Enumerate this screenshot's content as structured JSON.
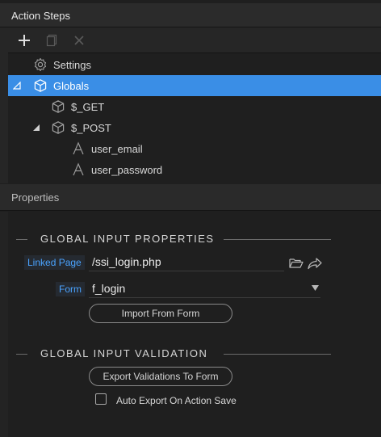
{
  "action_steps": {
    "title": "Action Steps",
    "toolbar": {
      "add_icon": "plus-icon",
      "copy_icon": "copy-icon",
      "delete_icon": "close-icon"
    },
    "tree": [
      {
        "label": "Settings",
        "icon": "gear-icon"
      },
      {
        "label": "Globals",
        "icon": "cube-icon",
        "expanded": true,
        "selected": true
      },
      {
        "label": "$_GET",
        "icon": "cube-icon"
      },
      {
        "label": "$_POST",
        "icon": "cube-icon",
        "expanded": true
      },
      {
        "label": "user_email",
        "icon": "text-a-icon"
      },
      {
        "label": "user_password",
        "icon": "text-a-icon"
      }
    ]
  },
  "properties": {
    "title": "Properties",
    "global_input": {
      "heading": "GLOBAL INPUT PROPERTIES",
      "linked_page_label": "Linked Page",
      "linked_page_value": "/ssi_login.php",
      "form_label": "Form",
      "form_value": "f_login",
      "import_button": "Import From Form"
    },
    "validation": {
      "heading": "GLOBAL INPUT VALIDATION",
      "export_button": "Export Validations To Form",
      "auto_export_label": "Auto Export On Action Save",
      "auto_export_checked": false
    }
  },
  "colors": {
    "selected_row": "#3a8ee6",
    "label_accent": "#4aa3ff",
    "background": "#1f1f1f"
  }
}
